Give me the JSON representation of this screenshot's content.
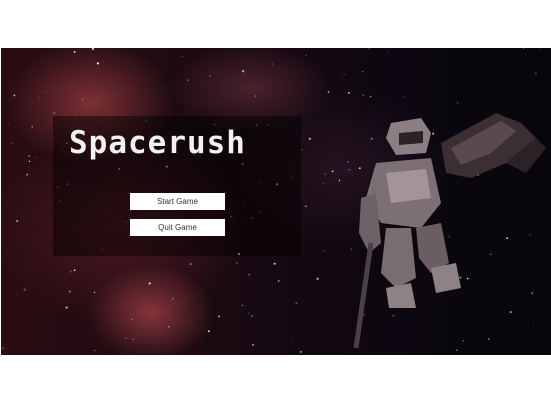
{
  "game": {
    "title": "Spacerush",
    "menu": {
      "start_label": "Start Game",
      "quit_label": "Quit Game"
    }
  },
  "colors": {
    "panel": "#000000",
    "button_bg": "#ffffff",
    "title_text": "#f1f1f1"
  }
}
